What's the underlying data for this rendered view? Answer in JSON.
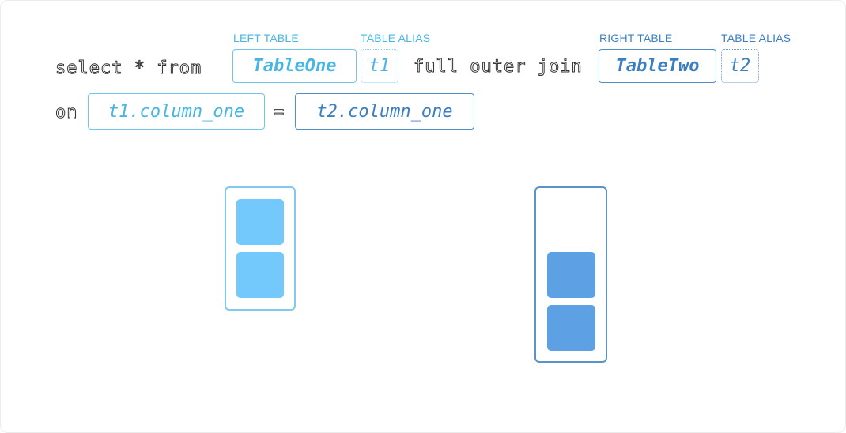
{
  "captions": {
    "left_table": "LEFT TABLE",
    "left_alias": "TABLE ALIAS",
    "right_table": "RIGHT TABLE",
    "right_alias": "TABLE ALIAS"
  },
  "query": {
    "select": "select * from",
    "left_table": "TableOne",
    "left_alias": "t1",
    "join": "full outer join",
    "right_table": "TableTwo",
    "right_alias": "t2",
    "on": "on",
    "left_column": "t1.column_one",
    "equals": "=",
    "right_column": "t2.column_one"
  },
  "diagram": {
    "left_table_rows": 2,
    "right_table_rows": 2
  },
  "colors": {
    "left": "#73c9fb",
    "right": "#5da0e3",
    "left_text": "#48b6e2",
    "right_text": "#3b7fc0"
  }
}
